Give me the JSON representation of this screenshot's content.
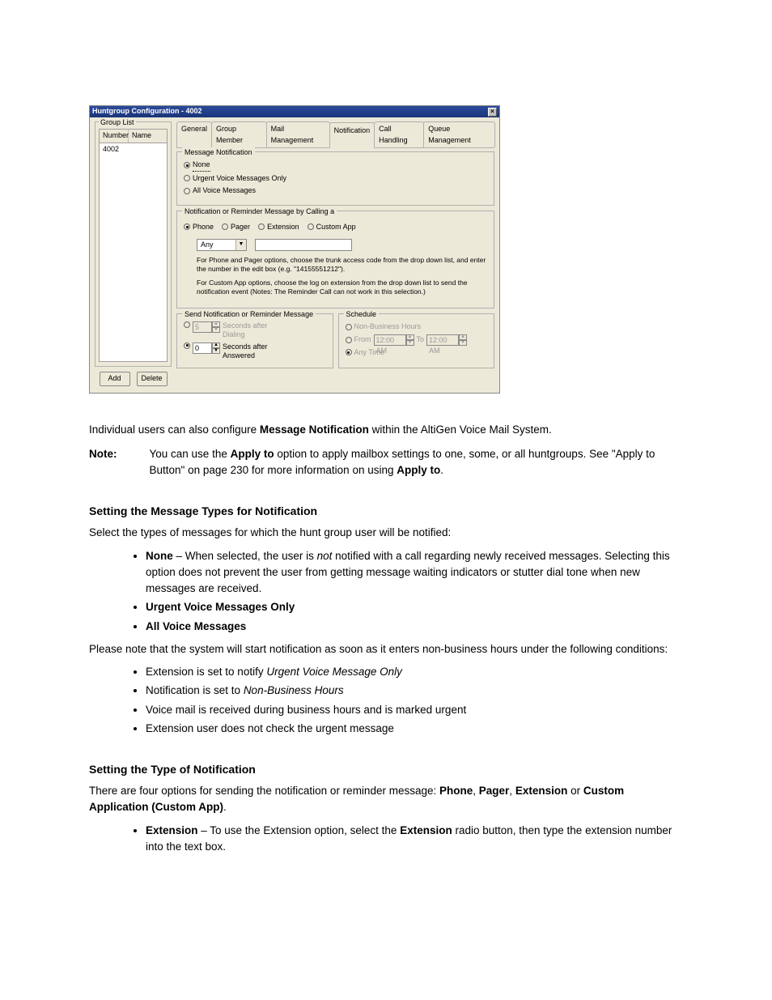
{
  "dialog": {
    "title": "Huntgroup Configuration - 4002",
    "groupList": {
      "legend": "Group List",
      "cols": {
        "number": "Number",
        "name": "Name"
      },
      "row": "4002",
      "buttons": {
        "add": "Add",
        "delete": "Delete"
      }
    },
    "tabs": {
      "general": "General",
      "member": "Group Member",
      "mail": "Mail Management",
      "notification": "Notification",
      "call": "Call Handling",
      "queue": "Queue Management"
    },
    "msgNotif": {
      "legend": "Message Notification",
      "none": "None",
      "urgent": "Urgent Voice Messages Only",
      "all": "All Voice Messages"
    },
    "byCalling": {
      "legend": "Notification or Reminder Message by Calling a",
      "phone": "Phone",
      "pager": "Pager",
      "extension": "Extension",
      "custom": "Custom App",
      "anyLabel": "Any",
      "help1": "For Phone and Pager options, choose the trunk access code from the drop down list, and enter the number in the edit box (e.g. \"14155551212\").",
      "help2": "For Custom App options, choose the log on extension from the drop down list to send the notification event (Notes: The Reminder Call can not work in this selection.)"
    },
    "send": {
      "legend": "Send Notification or Reminder Message",
      "opt1a": "Seconds after",
      "opt1b": "Dialing",
      "val1": "5",
      "opt2a": "Seconds after",
      "opt2b": "Answered",
      "val2": "0"
    },
    "schedule": {
      "legend": "Schedule",
      "nbh": "Non-Business Hours",
      "from": "From",
      "to": "To",
      "time": "12:00 AM",
      "any": "Any Time"
    }
  },
  "doc": {
    "p1a": "Individual users can also configure ",
    "p1b": "Message Notification",
    "p1c": " within the AltiGen Voice Mail System.",
    "note": {
      "label": "Note:",
      "t1": "You can use the ",
      "t2": "Apply to",
      "t3": " option to apply mailbox settings to one, some, or all huntgroups. See \"Apply to Button\" on page 230 for more information on using ",
      "t4": "Apply to",
      "t5": "."
    },
    "sec1": "Setting the Message Types for Notification",
    "p2": "Select the types of messages for which the hunt group user will be notified:",
    "bNone1": "None",
    "bNone2": " – When selected, the user is ",
    "bNone3": "not",
    "bNone4": " notified with a call regarding newly received messages. Selecting this option does not prevent the user from getting message waiting indicators or stutter dial tone when new messages are received.",
    "bUrgent": "Urgent Voice Messages Only",
    "bAll": "All Voice Messages",
    "p3": "Please note that the system will start notification as soon as it enters non-business hours under the following conditions:",
    "cond1a": "Extension is set to notify ",
    "cond1b": "Urgent Voice Message Only",
    "cond2a": "Notification is set to ",
    "cond2b": "Non-Business Hours",
    "cond3": "Voice mail is received during business hours and is marked urgent",
    "cond4": "Extension user does not check the urgent message",
    "sec2": "Setting the Type of Notification",
    "p4a": "There are four options for sending the notification or reminder message: ",
    "p4b": "Phone",
    "p4c": "Pager",
    "p4d": "Extension",
    "p4e": "Custom Application (Custom App)",
    "bExt1": "Extension",
    "bExt2": " – To use the Extension option, select the ",
    "bExt3": "Extension",
    "bExt4": " radio button, then type the extension number into the text box."
  }
}
